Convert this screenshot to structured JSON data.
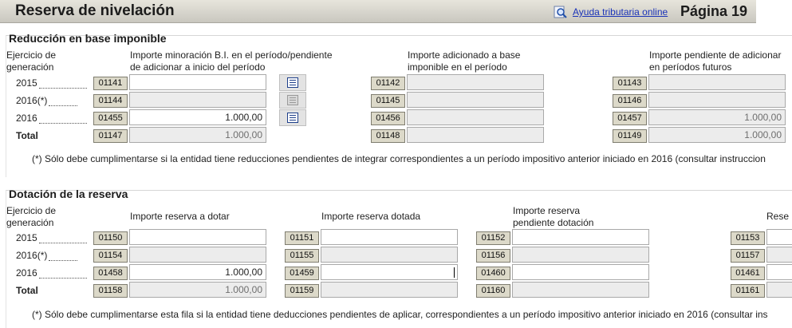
{
  "header": {
    "title": "Reserva de nivelación",
    "help_link": "Ayuda tributaria online",
    "page": "Página 19"
  },
  "section1": {
    "title": "Reducción en base imponible",
    "col_ejercicio": [
      "Ejercicio de",
      "generación"
    ],
    "col_a": [
      "Importe minoración B.I. en el período/pendiente",
      "de adicionar a inicio del período"
    ],
    "col_b": [
      "Importe adicionado a base",
      "imponible en el período"
    ],
    "col_c": [
      "Importe pendiente de adicionar",
      "en períodos futuros"
    ],
    "rows": [
      {
        "label": "2015",
        "codes": [
          "01141",
          "01142",
          "01143"
        ],
        "values": [
          "",
          "",
          ""
        ]
      },
      {
        "label": "2016(*)",
        "codes": [
          "01144",
          "01145",
          "01146"
        ],
        "values": [
          "",
          "",
          ""
        ]
      },
      {
        "label": "2016",
        "codes": [
          "01455",
          "01456",
          "01457"
        ],
        "values": [
          "1.000,00",
          "",
          "1.000,00"
        ]
      },
      {
        "label": "Total",
        "codes": [
          "01147",
          "01148",
          "01149"
        ],
        "values": [
          "1.000,00",
          "",
          "1.000,00"
        ]
      }
    ],
    "note": "(*) Sólo debe cumplimentarse si la entidad tiene reducciones pendientes de integrar correspondientes a un período impositivo anterior iniciado en 2016 (consultar instruccion"
  },
  "section2": {
    "title": "Dotación de la reserva",
    "col_ejercicio": [
      "Ejercicio de",
      "generación"
    ],
    "col_a": "Importe reserva a dotar",
    "col_b": "Importe reserva dotada",
    "col_c": [
      "Importe reserva",
      "pendiente dotación"
    ],
    "col_d": "Rese",
    "rows": [
      {
        "label": "2015",
        "codes": [
          "01150",
          "01151",
          "01152",
          "01153"
        ],
        "values": [
          "",
          "",
          "",
          ""
        ]
      },
      {
        "label": "2016(*)",
        "codes": [
          "01154",
          "01155",
          "01156",
          "01157"
        ],
        "values": [
          "",
          "",
          "",
          ""
        ]
      },
      {
        "label": "2016",
        "codes": [
          "01458",
          "01459",
          "01460",
          "01461"
        ],
        "values": [
          "1.000,00",
          "",
          "",
          ""
        ]
      },
      {
        "label": "Total",
        "codes": [
          "01158",
          "01159",
          "01160",
          "01161"
        ],
        "values": [
          "1.000,00",
          "",
          "",
          ""
        ]
      }
    ],
    "note": "(*) Sólo debe cumplimentarse esta fila si la entidad tiene deducciones pendientes de aplicar, correspondientes a un período impositivo anterior iniciado en 2016 (consultar ins"
  }
}
